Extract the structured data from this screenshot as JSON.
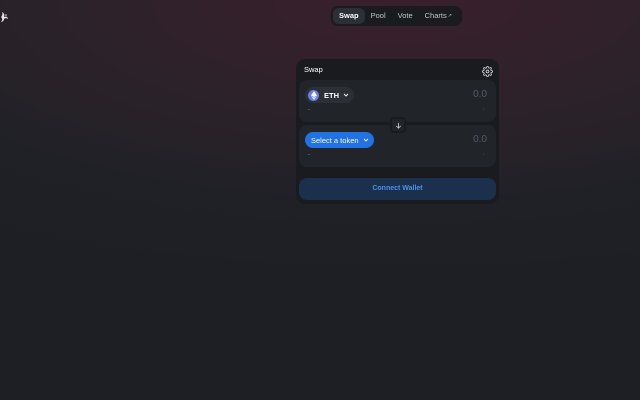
{
  "nav": {
    "items": [
      {
        "label": "Swap",
        "active": true
      },
      {
        "label": "Pool",
        "active": false
      },
      {
        "label": "Vote",
        "active": false
      },
      {
        "label": "Charts",
        "active": false,
        "suffix": "↗"
      }
    ]
  },
  "swap": {
    "title": "Swap",
    "input": {
      "token_symbol": "ETH",
      "token_icon": "eth-icon",
      "amount_placeholder": "0.0",
      "fiat_value": "-",
      "mini_label": "↑"
    },
    "output": {
      "select_label": "Select a token",
      "amount_placeholder": "0.0",
      "fiat_value": "-",
      "mini_label": "↑"
    },
    "connect_label": "Connect Wallet"
  },
  "colors": {
    "accent": "#2172e5",
    "connect_text": "#4f8fe6",
    "connect_bg": "#1a304c",
    "card_bg": "#191b1f",
    "panel_bg": "#212429"
  },
  "icons": [
    "uniswap-logo-icon",
    "settings-gear-icon",
    "eth-icon",
    "chevron-down-icon",
    "arrow-down-icon"
  ]
}
